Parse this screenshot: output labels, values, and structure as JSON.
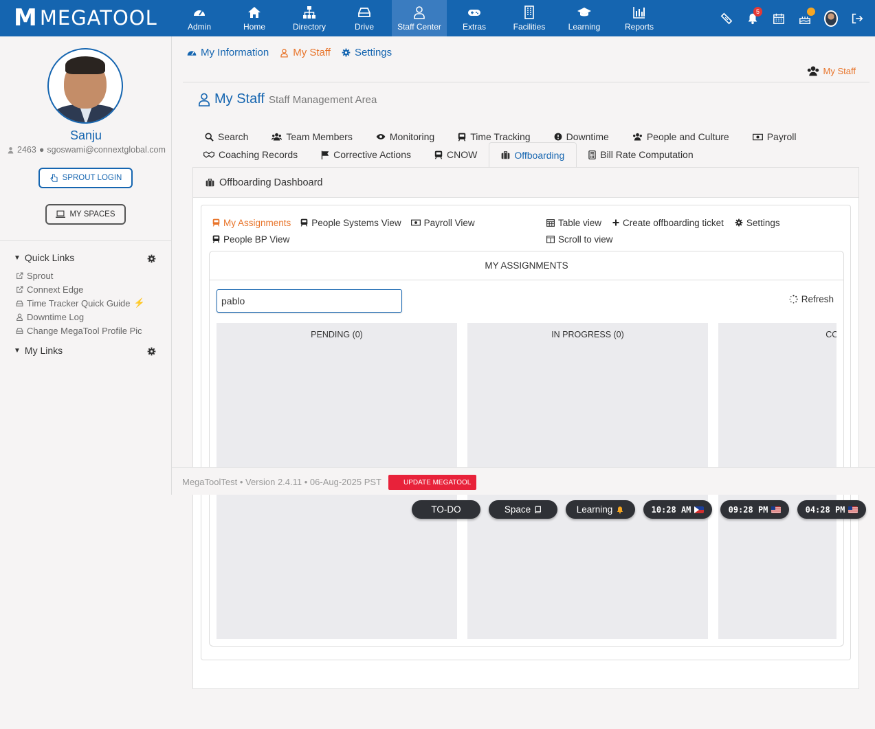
{
  "app": {
    "logo_m": "M",
    "logo_text": "MEGATOOL"
  },
  "nav": [
    {
      "label": "Admin",
      "icon": "dashboard-icon"
    },
    {
      "label": "Home",
      "icon": "home-icon"
    },
    {
      "label": "Directory",
      "icon": "sitemap-icon"
    },
    {
      "label": "Drive",
      "icon": "drive-icon"
    },
    {
      "label": "Staff Center",
      "icon": "user-icon",
      "active": true
    },
    {
      "label": "Extras",
      "icon": "gamepad-icon"
    },
    {
      "label": "Facilities",
      "icon": "building-icon"
    },
    {
      "label": "Learning",
      "icon": "graduation-cap-icon"
    },
    {
      "label": "Reports",
      "icon": "bar-chart-icon"
    }
  ],
  "top_icons": {
    "notification_count": "5"
  },
  "sidebar": {
    "user_name": "Sanju",
    "user_id": "2463",
    "user_email": "sgoswami@connextglobal.com",
    "sprout_login": "SPROUT LOGIN",
    "my_spaces": "MY SPACES",
    "quick_links_title": "Quick Links",
    "quick_links": [
      {
        "label": "Sprout",
        "icon": "external-link-icon"
      },
      {
        "label": "Connext Edge",
        "icon": "external-link-icon"
      },
      {
        "label": "Time Tracker Quick Guide",
        "icon": "drive-icon"
      },
      {
        "label": "Downtime Log",
        "icon": "user-icon"
      },
      {
        "label": "Change MegaTool Profile Pic",
        "icon": "drive-icon"
      }
    ],
    "my_links_title": "My Links"
  },
  "subnav": {
    "my_information": "My Information",
    "my_staff": "My Staff",
    "settings": "Settings"
  },
  "breadcrumb": "My Staff",
  "page": {
    "title": "My Staff",
    "subtitle": "Staff Management Area"
  },
  "tabs_row1": [
    "Search",
    "Team Members",
    "Monitoring",
    "Time Tracking",
    "Downtime",
    "People and Culture",
    "Payroll"
  ],
  "tabs_row2": [
    "Coaching Records",
    "Corrective Actions",
    "CNOW",
    "Offboarding",
    "Bill Rate Computation"
  ],
  "panel": {
    "title": "Offboarding Dashboard"
  },
  "views": {
    "my_assignments": "My Assignments",
    "people_systems_view": "People Systems View",
    "payroll_view": "Payroll View",
    "people_bp_view": "People BP View",
    "table_view": "Table view",
    "create_ticket": "Create offboarding ticket",
    "settings": "Settings",
    "scroll_to_view": "Scroll to view"
  },
  "assignments": {
    "title": "MY ASSIGNMENTS",
    "search_value": "pablo",
    "refresh": "Refresh",
    "columns": [
      "PENDING (0)",
      "IN PROGRESS (0)",
      "COMP"
    ]
  },
  "footer": {
    "version_text": "MegaToolTest • Version 2.4.11 • 06-Aug-2025 PST",
    "update_label": "UPDATE MEGATOOL"
  },
  "pills": {
    "todo": "TO-DO",
    "space": "Space",
    "learning": "Learning",
    "clock_ph": "10:28 AM",
    "clock_us1": "09:28 PM",
    "clock_us2": "04:28 PM"
  },
  "colors": {
    "brand": "#1565b0",
    "accent": "#e8742a",
    "alert": "#e8223a"
  }
}
